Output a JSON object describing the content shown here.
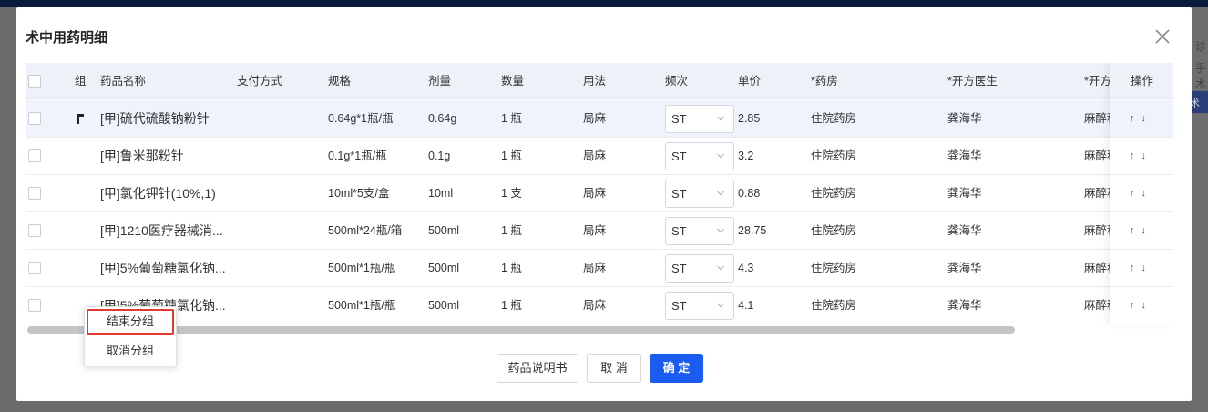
{
  "background": {
    "right_text_1": "诊",
    "right_text_2": "手术",
    "right_button": "术"
  },
  "dialog": {
    "title": "术中用药明细"
  },
  "columns": {
    "group": "组",
    "name": "药品名称",
    "payment": "支付方式",
    "spec": "规格",
    "dose": "剂量",
    "qty": "数量",
    "usage": "用法",
    "freq": "频次",
    "price": "单价",
    "pharmacy": "*药房",
    "doctor": "*开方医生",
    "dept": "*开方",
    "op": "操作"
  },
  "rows": [
    {
      "name": "[甲]硫代硫酸钠粉针",
      "spec": "0.64g*1瓶/瓶",
      "dose": "0.64g",
      "qty": "1 瓶",
      "usage": "局麻",
      "freq": "ST",
      "price": "2.85",
      "pharmacy": "住院药房",
      "doctor": "龚海华",
      "dept": "麻醉科",
      "arrows": "↑ ↓"
    },
    {
      "name": "[甲]鲁米那粉针",
      "spec": "0.1g*1瓶/瓶",
      "dose": "0.1g",
      "qty": "1 瓶",
      "usage": "局麻",
      "freq": "ST",
      "price": "3.2",
      "pharmacy": "住院药房",
      "doctor": "龚海华",
      "dept": "麻醉科",
      "arrows": "↑ ↓"
    },
    {
      "name": "[甲]氯化钾针(10%,1)",
      "spec": "10ml*5支/盒",
      "dose": "10ml",
      "qty": "1 支",
      "usage": "局麻",
      "freq": "ST",
      "price": "0.88",
      "pharmacy": "住院药房",
      "doctor": "龚海华",
      "dept": "麻醉科",
      "arrows": "↑ ↓"
    },
    {
      "name": "[甲]1210医疗器械消...",
      "spec": "500ml*24瓶/箱",
      "dose": "500ml",
      "qty": "1 瓶",
      "usage": "局麻",
      "freq": "ST",
      "price": "28.75",
      "pharmacy": "住院药房",
      "doctor": "龚海华",
      "dept": "麻醉科",
      "arrows": "↑ ↓"
    },
    {
      "name": "[甲]5%葡萄糖氯化钠...",
      "spec": "500ml*1瓶/瓶",
      "dose": "500ml",
      "qty": "1 瓶",
      "usage": "局麻",
      "freq": "ST",
      "price": "4.3",
      "pharmacy": "住院药房",
      "doctor": "龚海华",
      "dept": "麻醉科",
      "arrows": "↑ ↓"
    },
    {
      "name": "[甲]5%葡萄糖氯化钠...",
      "spec": "500ml*1瓶/瓶",
      "dose": "500ml",
      "qty": "1 瓶",
      "usage": "局麻",
      "freq": "ST",
      "price": "4.1",
      "pharmacy": "住院药房",
      "doctor": "龚海华",
      "dept": "麻醉科",
      "arrows": "↑ ↓"
    }
  ],
  "context_menu": {
    "end_group": "结束分组",
    "cancel_group": "取消分组"
  },
  "footer": {
    "instructions": "药品说明书",
    "cancel": "取 消",
    "confirm": "确 定"
  },
  "colors": {
    "primary": "#1a5cf0",
    "highlight_row": "#eef3fc",
    "header_bg": "#eef2f8",
    "menu_outline": "#e43a2e"
  }
}
